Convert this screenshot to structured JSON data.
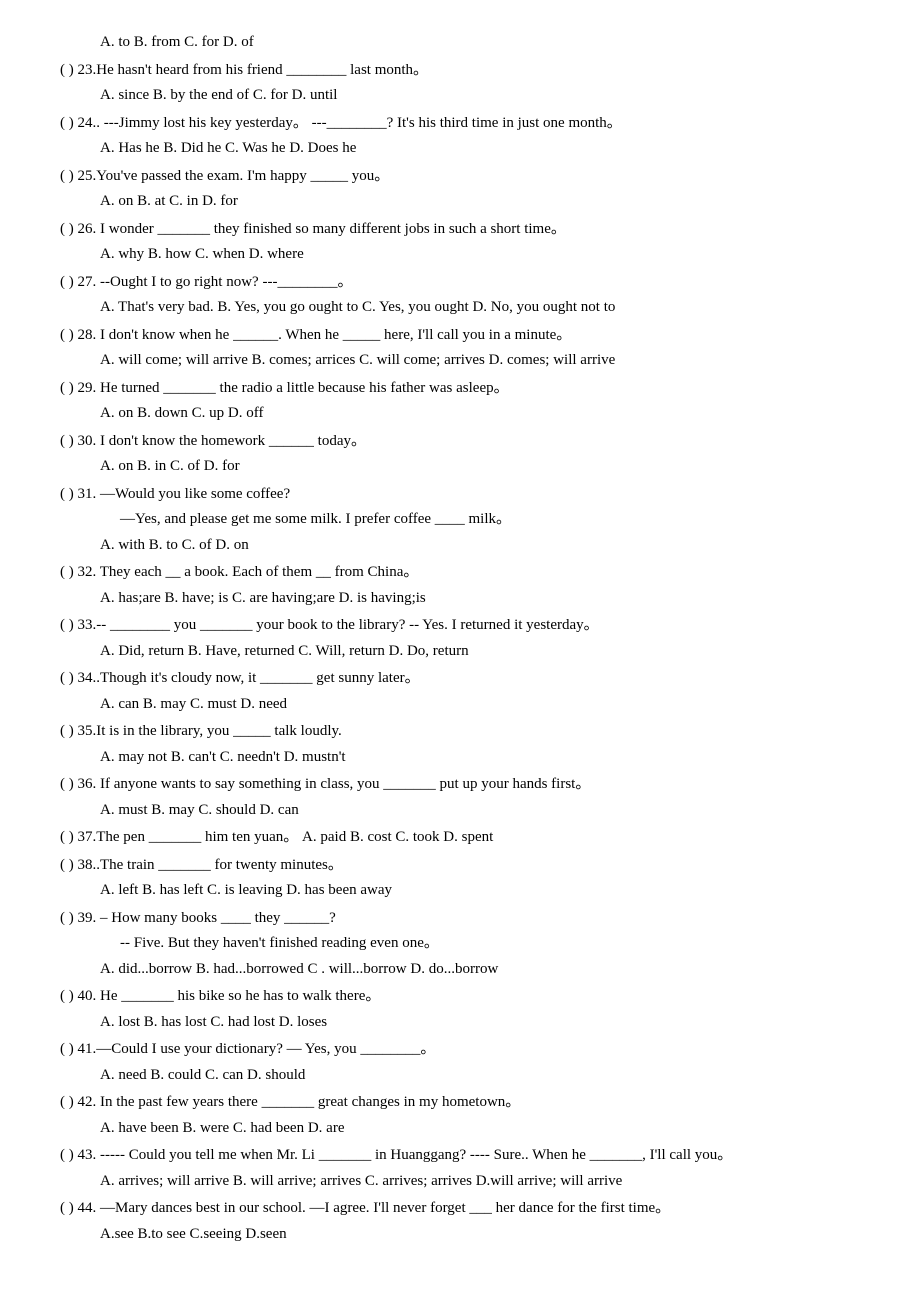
{
  "questions": [
    {
      "id": "top-options",
      "question": "",
      "options": "A. to          B. from          C. for          D. of"
    },
    {
      "id": "q23",
      "question": "( ) 23.He hasn't heard from his friend ________ last month。",
      "options": "A. since          B. by the end of          C. for          D. until"
    },
    {
      "id": "q24",
      "question": "( ) 24.. ---Jimmy lost his key yesterday。 ---________? It's his third time in just one month。",
      "options": "A. Has he     B. Did he     C. Was he     D. Does he"
    },
    {
      "id": "q25",
      "question": "( ) 25.You've passed the exam. I'm happy _____ you。",
      "options": "A. on          B. at          C. in          D. for"
    },
    {
      "id": "q26",
      "question": "( ) 26. I wonder _______ they finished so many different jobs in such a short time。",
      "options": "A. why          B. how          C. when          D. where"
    },
    {
      "id": "q27",
      "question": "( ) 27. --Ought I to go right now?  ---________。",
      "options": "A. That's very bad.  B. Yes, you go ought to   C. Yes, you ought   D. No, you ought not to"
    },
    {
      "id": "q28",
      "question": "( ) 28. I don't know when he ______. When he _____ here, I'll call you in a minute。",
      "options": "A. will come; will arrive  B. comes; arrices  C. will come; arrives    D. comes; will arrive"
    },
    {
      "id": "q29",
      "question": "( ) 29. He turned _______ the radio a little because his father was asleep。",
      "options": "A. on          B. down          C. up          D. off"
    },
    {
      "id": "q30",
      "question": "( ) 30. I don't know the homework ______ today。",
      "options": "A. on   B. in   C. of          D. for"
    },
    {
      "id": "q31",
      "question": "( ) 31. —Would you like some coffee?",
      "sub": "—Yes, and  please  get  me  some  milk.  I prefer coffee ____ milk。",
      "options": "A. with          B. to          C. of          D. on"
    },
    {
      "id": "q32",
      "question": "( ) 32. They each __ a book. Each of them __ from China。",
      "options": "A. has;are          B. have; is          C. are having;are          D. is having;is"
    },
    {
      "id": "q33",
      "question": "( ) 33.-- ________ you _______ your book to the library?  -- Yes. I returned it yesterday。",
      "options": "A. Did, return          B. Have, returned          C. Will, return          D. Do, return"
    },
    {
      "id": "q34",
      "question": "( ) 34..Though it's cloudy now, it _______ get sunny later。",
      "options": "A. can          B. may          C. must          D. need"
    },
    {
      "id": "q35",
      "question": "( ) 35.It is in the library, you _____ talk loudly.",
      "options": "A. may not          B. can't          C. needn't          D. mustn't"
    },
    {
      "id": "q36",
      "question": "( ) 36. If anyone wants to say something in class, you _______ put up your hands first。",
      "options": "A. must          B. may          C. should          D. can"
    },
    {
      "id": "q37",
      "question": "( ) 37.The pen _______ him ten yuan。          A. paid     B. cost     C. took   D. spent"
    },
    {
      "id": "q38",
      "question": "( ) 38..The train _______ for twenty minutes。",
      "options": "A. left          B. has left          C. is leaving          D. has been away"
    },
    {
      "id": "q39",
      "question": "( ) 39. – How many books ____ they ______?",
      "sub": "-- Five. But they haven't finished reading even one。",
      "options": "A. did...borrow    B. had...borrowed    C . will...borrow   D. do...borrow"
    },
    {
      "id": "q40",
      "question": "( ) 40. He _______ his bike so he has to walk there。",
      "options": "A. lost          B. has lost          C. had lost          D. loses"
    },
    {
      "id": "q41",
      "question": "( ) 41.—Could I use your dictionary?  — Yes, you ________。",
      "options": "A. need          B. could          C. can          D. should"
    },
    {
      "id": "q42",
      "question": "( ) 42. In the past few years there _______ great changes in my hometown。",
      "options": "A. have been          B. were          C. had been          D. are"
    },
    {
      "id": "q43",
      "question": "( ) 43. ----- Could you tell me when Mr. Li _______ in Huanggang? ---- Sure..  When he _______, I'll call you。",
      "options": "A. arrives;  will arrive   B. will arrive; arrives   C. arrives; arrives   D.will arrive; will arrive"
    },
    {
      "id": "q44",
      "question": "( ) 44. —Mary dances best in our school. —I agree. I'll never forget ___ her dance for the first time。",
      "options": "A.see          B.to see          C.seeing          D.seen"
    }
  ]
}
